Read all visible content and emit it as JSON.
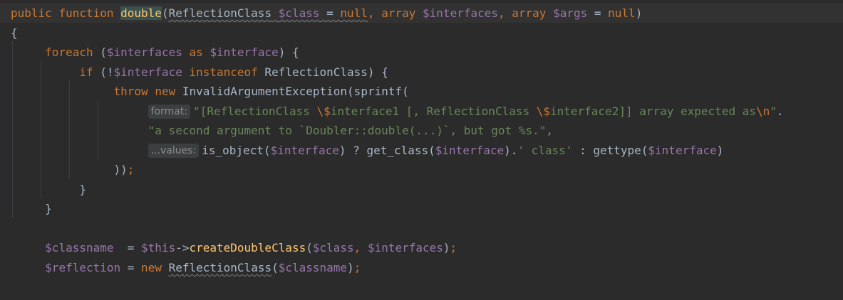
{
  "editor": {
    "line1": {
      "public": "public",
      "function": "function",
      "name": "double",
      "open": "(",
      "type1": "ReflectionClass",
      "var_class": "$class",
      "eq1": " = ",
      "null1": "null",
      "comma1": ", ",
      "array1": "array",
      "var_interfaces": "$interfaces",
      "comma2": ", ",
      "array2": "array",
      "var_args": "$args",
      "eq2": " = ",
      "null2": "null",
      "close": ")"
    },
    "line2": {
      "brace": "{"
    },
    "line3": {
      "foreach": "foreach",
      "open": " (",
      "var_interfaces": "$interfaces",
      "as": "as",
      "var_interface": "$interface",
      "close": ") {"
    },
    "line4": {
      "if": "if",
      "open": " (!",
      "var_interface": "$interface",
      "instanceof": "instanceof",
      "rest": " ReflectionClass) {"
    },
    "line5": {
      "throw": "throw",
      "new": "new",
      "rest": "InvalidArgumentException(sprintf("
    },
    "line6": {
      "hint": "format:",
      "str_a": "\"[ReflectionClass ",
      "esc1": "\\$",
      "str_b": "interface1 [, ReflectionClass ",
      "esc2": "\\$",
      "str_c": "interface2]] array expected as",
      "esc3": "\\n",
      "str_d": "\"",
      "dot": "."
    },
    "line7": {
      "str": "\"a second argument to `Doubler::double(...)`, but got %s.\"",
      "comma": ","
    },
    "line8": {
      "hint": "...values:",
      "fn1": "is_object(",
      "var1": "$interface",
      "mid1": ") ? get_class(",
      "var2": "$interface",
      "mid2": ").",
      "str": "' class'",
      "mid3": " : gettype(",
      "var3": "$interface",
      "end": ")"
    },
    "line9": {
      "close": "))",
      "semi": ";"
    },
    "line10": {
      "brace": "}"
    },
    "line11": {
      "brace": "}"
    },
    "line13": {
      "var_classname": "$classname",
      "eq": "  = ",
      "var_this": "$this",
      "arrow": "->",
      "method": "createDoubleClass",
      "open": "(",
      "var_class": "$class",
      "comma": ", ",
      "var_interfaces": "$interfaces",
      "close": ")",
      "semi": ";"
    },
    "line14": {
      "var_reflection": "$reflection",
      "eq": " = ",
      "new": "new",
      "cls": "ReflectionClass",
      "open": "(",
      "var_classname": "$classname",
      "close": ")",
      "semi": ";"
    }
  }
}
